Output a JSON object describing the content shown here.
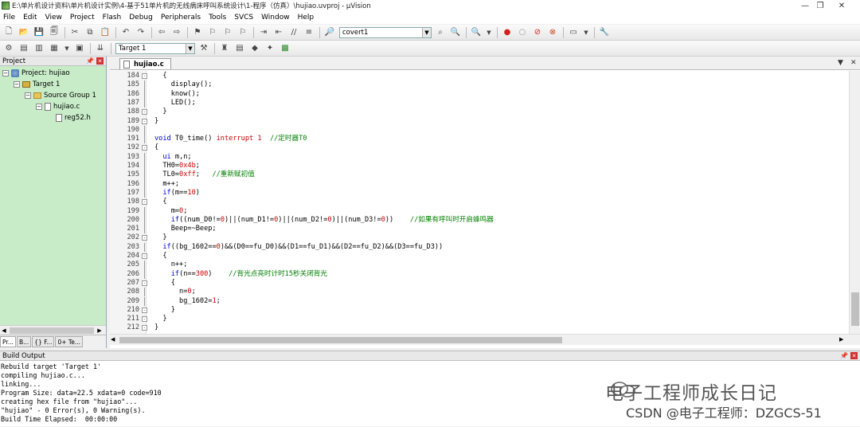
{
  "window": {
    "title": "E:\\单片机设计资料\\单片机设计实例\\4-基于51单片机的无线病床呼叫系统设计\\1-程序（仿真）\\hujiao.uvproj - µVision"
  },
  "menu": [
    "File",
    "Edit",
    "View",
    "Project",
    "Flash",
    "Debug",
    "Peripherals",
    "Tools",
    "SVCS",
    "Window",
    "Help"
  ],
  "toolbar1": {
    "find_combo": "covert1"
  },
  "toolbar2": {
    "target_combo": "Target 1"
  },
  "project": {
    "header": "Project",
    "tree": [
      {
        "label": "Project: hujiao",
        "level": 0,
        "icon": "project-icon"
      },
      {
        "label": "Target 1",
        "level": 1,
        "icon": "target-icon"
      },
      {
        "label": "Source Group 1",
        "level": 2,
        "icon": "folder-icon"
      },
      {
        "label": "hujiao.c",
        "level": 3,
        "icon": "file-icon"
      },
      {
        "label": "reg52.h",
        "level": 4,
        "icon": "file-icon"
      }
    ],
    "tabs": [
      "Pr...",
      "B...",
      "{} F...",
      "0+ Te..."
    ]
  },
  "editor": {
    "tab": "hujiao.c",
    "lines": [
      {
        "n": "184",
        "fold": "-",
        "code": "  {"
      },
      {
        "n": "185",
        "fold": "",
        "code": "    display();"
      },
      {
        "n": "186",
        "fold": "",
        "code": "    know();"
      },
      {
        "n": "187",
        "fold": "",
        "code": "    LED();"
      },
      {
        "n": "188",
        "fold": "-",
        "code": "  }"
      },
      {
        "n": "189",
        "fold": "-",
        "code": "}"
      },
      {
        "n": "190",
        "fold": "",
        "code": ""
      },
      {
        "n": "191",
        "fold": "",
        "code": "void T0_time() interrupt 1  //定时器T0"
      },
      {
        "n": "192",
        "fold": "-",
        "code": "{"
      },
      {
        "n": "193",
        "fold": "",
        "code": "  ui m,n;"
      },
      {
        "n": "194",
        "fold": "",
        "code": "  TH0=0x4b;"
      },
      {
        "n": "195",
        "fold": "",
        "code": "  TL0=0xff;   //重新赋初值"
      },
      {
        "n": "196",
        "fold": "",
        "code": "  m++;"
      },
      {
        "n": "197",
        "fold": "",
        "code": "  if(m==10)"
      },
      {
        "n": "198",
        "fold": "-",
        "code": "  {"
      },
      {
        "n": "199",
        "fold": "",
        "code": "    m=0;"
      },
      {
        "n": "200",
        "fold": "",
        "code": "    if((num_D0!=0)||(num_D1!=0)||(num_D2!=0)||(num_D3!=0))    //如果有呼叫时开启蜂鸣器"
      },
      {
        "n": "201",
        "fold": "",
        "code": "    Beep=~Beep;"
      },
      {
        "n": "202",
        "fold": "-",
        "code": "  }"
      },
      {
        "n": "203",
        "fold": "",
        "code": "  if((bg_1602==0)&&(D0==fu_D0)&&(D1==fu_D1)&&(D2==fu_D2)&&(D3==fu_D3))"
      },
      {
        "n": "204",
        "fold": "-",
        "code": "  {"
      },
      {
        "n": "205",
        "fold": "",
        "code": "    n++;"
      },
      {
        "n": "206",
        "fold": "",
        "code": "    if(n==300)    //背光点亮时计时15秒关闭背光"
      },
      {
        "n": "207",
        "fold": "-",
        "code": "    {"
      },
      {
        "n": "208",
        "fold": "",
        "code": "      n=0;"
      },
      {
        "n": "209",
        "fold": "",
        "code": "      bg_1602=1;"
      },
      {
        "n": "210",
        "fold": "-",
        "code": "    }"
      },
      {
        "n": "211",
        "fold": "-",
        "code": "  }"
      },
      {
        "n": "212",
        "fold": "-",
        "code": "}"
      }
    ]
  },
  "build": {
    "header": "Build Output",
    "lines": [
      "Rebuild target 'Target 1'",
      "compiling hujiao.c...",
      "linking...",
      "Program Size: data=22.5 xdata=0 code=910",
      "creating hex file from \"hujiao\"...",
      "\"hujiao\" - 0 Error(s), 0 Warning(s).",
      "Build Time Elapsed:  00:00:00"
    ]
  },
  "watermark": {
    "line1": "电子工程师成长日记",
    "line2": "CSDN @电子工程师：DZGCS-51"
  }
}
